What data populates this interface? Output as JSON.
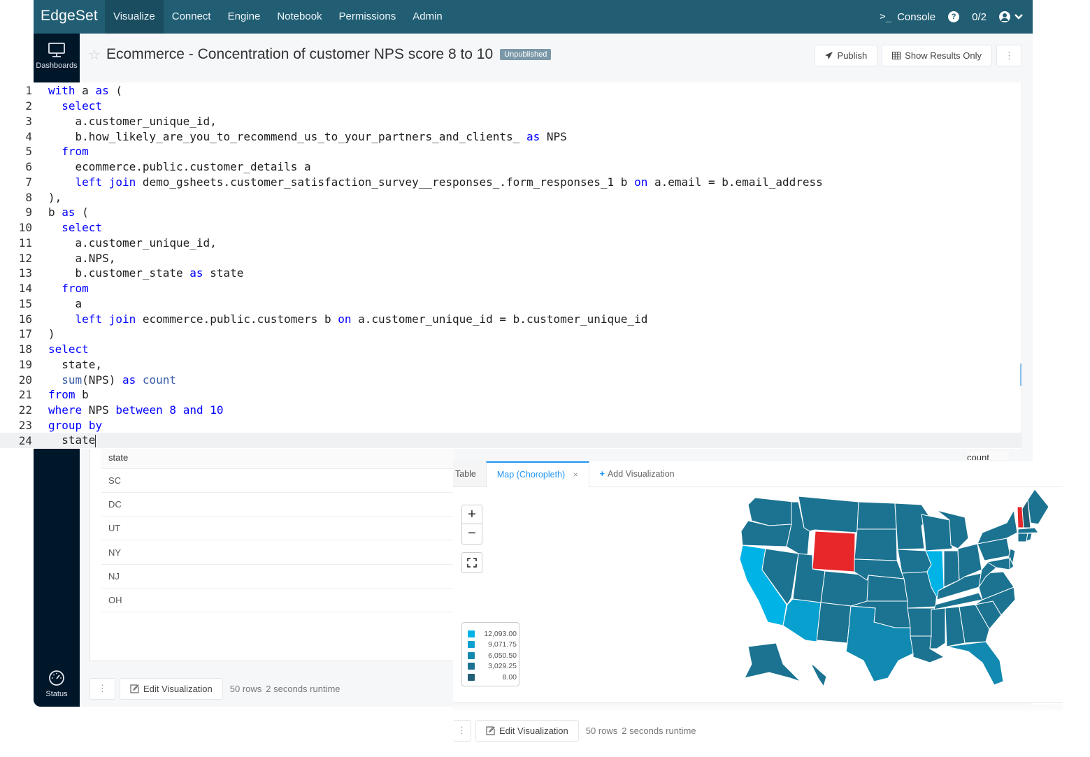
{
  "topnav": {
    "brand": "EdgeSet",
    "items": [
      {
        "label": "Visualize",
        "active": true
      },
      {
        "label": "Connect",
        "active": false
      },
      {
        "label": "Engine",
        "active": false
      },
      {
        "label": "Notebook",
        "active": false
      },
      {
        "label": "Permissions",
        "active": false
      },
      {
        "label": "Admin",
        "active": false
      }
    ],
    "console_label": "Console",
    "help_icon": "question-circle-icon",
    "counter": "0/2",
    "user_icon": "user-circle-icon"
  },
  "sidebar": {
    "items": [
      {
        "label": "Dashboards",
        "icon": "monitor-icon"
      },
      {
        "label": "Status",
        "icon": "gauge-icon"
      }
    ]
  },
  "titlebar": {
    "title": "Ecommerce - Concentration of customer NPS score 8 to 10",
    "badge": "Unpublished",
    "publish_label": "Publish",
    "show_results_label": "Show Results Only",
    "more_label": "⋮"
  },
  "editor": {
    "current_line": 24,
    "lines": [
      "with a as (",
      "  select",
      "    a.customer_unique_id,",
      "    b.how_likely_are_you_to_recommend_us_to_your_partners_and_clients_ as NPS",
      "  from",
      "    ecommerce.public.customer_details a",
      "    left join demo_gsheets.customer_satisfaction_survey__responses_.form_responses_1 b on a.email = b.email_address",
      "),",
      "b as (",
      "  select",
      "    a.customer_unique_id,",
      "    a.NPS,",
      "    b.customer_state as state",
      "  from",
      "    a",
      "    left join ecommerce.public.customers b on a.customer_unique_id = b.customer_unique_id",
      ")",
      "select",
      "  state,",
      "  sum(NPS) as count",
      "from b",
      "where NPS between 8 and 10",
      "group by",
      "  state"
    ]
  },
  "results": {
    "columns": [
      "state",
      "count"
    ],
    "rows": [
      "SC",
      "DC",
      "UT",
      "NY",
      "NJ",
      "OH"
    ],
    "more_label": "⋮",
    "edit_label": "Edit Visualization",
    "rows_text": "50 rows",
    "runtime_text": "2 seconds runtime"
  },
  "viz": {
    "tabs": [
      {
        "label": "Table"
      },
      {
        "label": "Map (Choropleth)",
        "active": true,
        "close": "×"
      },
      {
        "label": "Add Visualization",
        "plus": "+"
      }
    ],
    "zoom_in": "+",
    "zoom_out": "−",
    "legend": [
      {
        "label": "12,093.00",
        "color": "#00b3e6"
      },
      {
        "label": "9,071.75",
        "color": "#08a0cf"
      },
      {
        "label": "6,050.50",
        "color": "#1189b0"
      },
      {
        "label": "3,029.25",
        "color": "#1b7391"
      },
      {
        "label": "8.00",
        "color": "#225f77"
      }
    ],
    "highlight_color": "#e8272a",
    "state_fills": {
      "CA": "#00b3e6",
      "IL": "#00b3e6",
      "AZ": "#08a0cf",
      "TX": "#1189b0",
      "FL": "#1189b0",
      "WY": "#e8272a",
      "VT": "#e8272a",
      "NH": "#225f77",
      "default": "#1b7391"
    },
    "edit_label": "Edit Visualization",
    "more_label": "⋮",
    "rows_text": "50 rows",
    "runtime_text": "2 seconds runtime"
  }
}
